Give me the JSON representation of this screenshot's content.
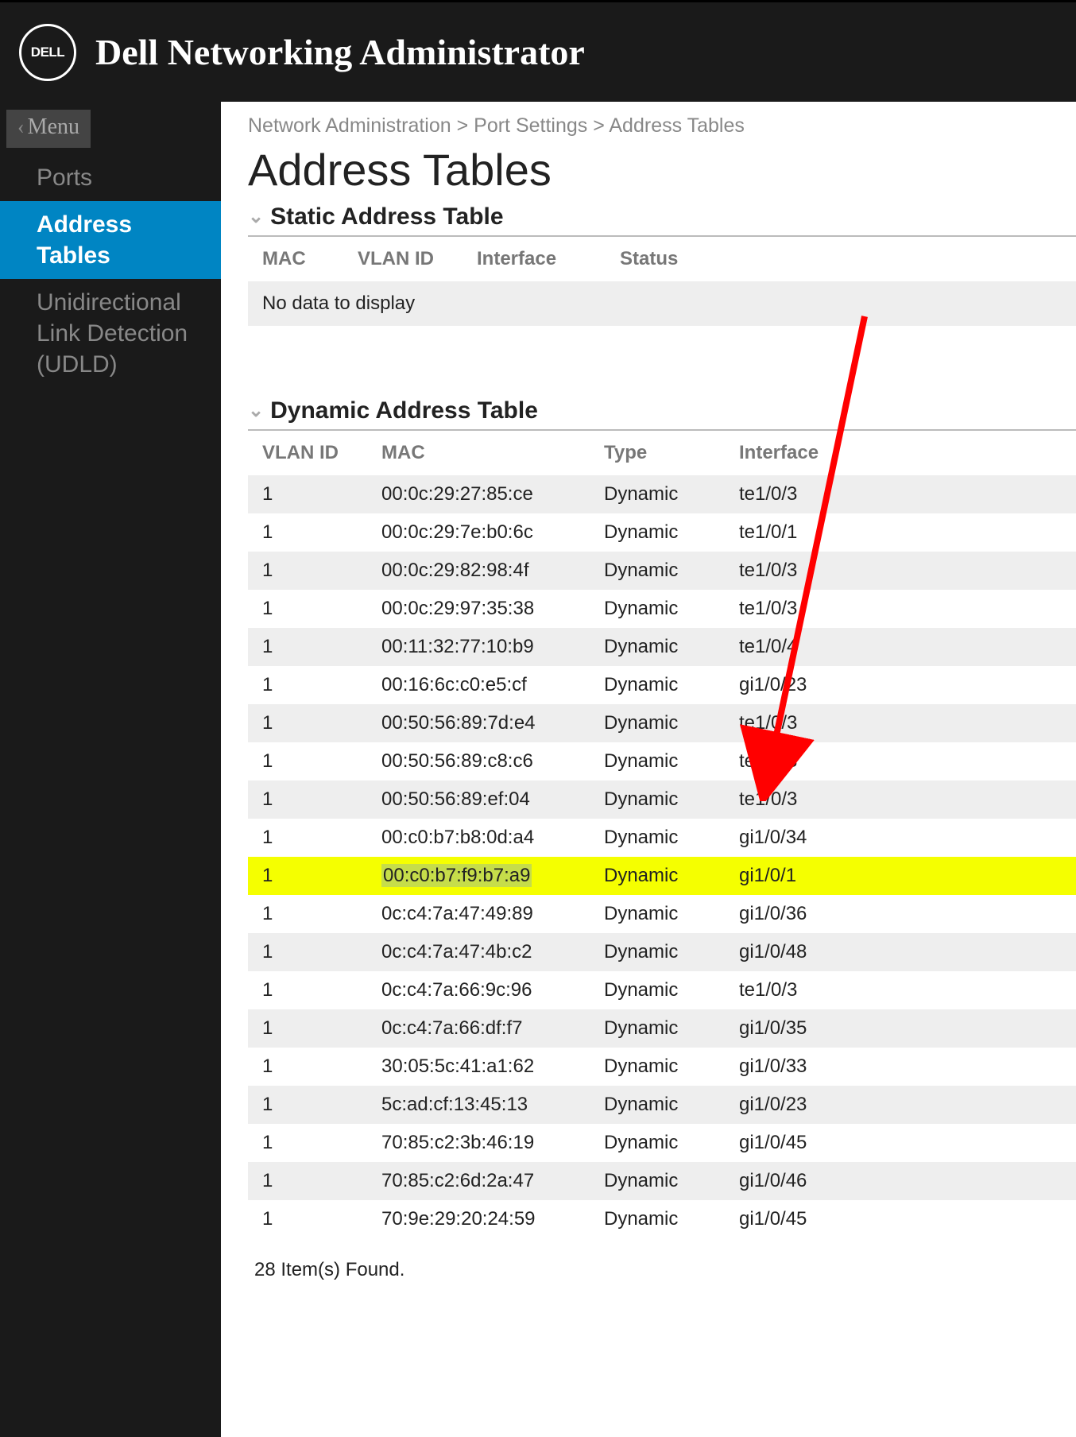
{
  "app": {
    "title": "Dell Networking Administrator",
    "logo_text": "DELL"
  },
  "menu_back": "Menu",
  "sidebar": {
    "items": [
      {
        "label": "Ports",
        "active": false
      },
      {
        "label": "Address Tables",
        "active": true
      },
      {
        "label": "Unidirectional Link Detection (UDLD)",
        "active": false
      }
    ]
  },
  "breadcrumb": "Network Administration > Port Settings > Address Tables",
  "page_title": "Address Tables",
  "static_section": {
    "title": "Static Address Table",
    "columns": [
      "MAC",
      "VLAN ID",
      "Interface",
      "Status"
    ],
    "no_data": "No data to display"
  },
  "dynamic_section": {
    "title": "Dynamic Address Table",
    "columns": [
      "VLAN ID",
      "MAC",
      "Type",
      "Interface"
    ],
    "rows": [
      {
        "vlan": "1",
        "mac": "00:0c:29:27:85:ce",
        "type": "Dynamic",
        "interface": "te1/0/3"
      },
      {
        "vlan": "1",
        "mac": "00:0c:29:7e:b0:6c",
        "type": "Dynamic",
        "interface": "te1/0/1"
      },
      {
        "vlan": "1",
        "mac": "00:0c:29:82:98:4f",
        "type": "Dynamic",
        "interface": "te1/0/3"
      },
      {
        "vlan": "1",
        "mac": "00:0c:29:97:35:38",
        "type": "Dynamic",
        "interface": "te1/0/3"
      },
      {
        "vlan": "1",
        "mac": "00:11:32:77:10:b9",
        "type": "Dynamic",
        "interface": "te1/0/4"
      },
      {
        "vlan": "1",
        "mac": "00:16:6c:c0:e5:cf",
        "type": "Dynamic",
        "interface": "gi1/0/23"
      },
      {
        "vlan": "1",
        "mac": "00:50:56:89:7d:e4",
        "type": "Dynamic",
        "interface": "te1/0/3"
      },
      {
        "vlan": "1",
        "mac": "00:50:56:89:c8:c6",
        "type": "Dynamic",
        "interface": "te1/0/3"
      },
      {
        "vlan": "1",
        "mac": "00:50:56:89:ef:04",
        "type": "Dynamic",
        "interface": "te1/0/3"
      },
      {
        "vlan": "1",
        "mac": "00:c0:b7:b8:0d:a4",
        "type": "Dynamic",
        "interface": "gi1/0/34"
      },
      {
        "vlan": "1",
        "mac": "00:c0:b7:f9:b7:a9",
        "type": "Dynamic",
        "interface": "gi1/0/1",
        "highlight": true
      },
      {
        "vlan": "1",
        "mac": "0c:c4:7a:47:49:89",
        "type": "Dynamic",
        "interface": "gi1/0/36"
      },
      {
        "vlan": "1",
        "mac": "0c:c4:7a:47:4b:c2",
        "type": "Dynamic",
        "interface": "gi1/0/48"
      },
      {
        "vlan": "1",
        "mac": "0c:c4:7a:66:9c:96",
        "type": "Dynamic",
        "interface": "te1/0/3"
      },
      {
        "vlan": "1",
        "mac": "0c:c4:7a:66:df:f7",
        "type": "Dynamic",
        "interface": "gi1/0/35"
      },
      {
        "vlan": "1",
        "mac": "30:05:5c:41:a1:62",
        "type": "Dynamic",
        "interface": "gi1/0/33"
      },
      {
        "vlan": "1",
        "mac": "5c:ad:cf:13:45:13",
        "type": "Dynamic",
        "interface": "gi1/0/23"
      },
      {
        "vlan": "1",
        "mac": "70:85:c2:3b:46:19",
        "type": "Dynamic",
        "interface": "gi1/0/45"
      },
      {
        "vlan": "1",
        "mac": "70:85:c2:6d:2a:47",
        "type": "Dynamic",
        "interface": "gi1/0/46"
      },
      {
        "vlan": "1",
        "mac": "70:9e:29:20:24:59",
        "type": "Dynamic",
        "interface": "gi1/0/45"
      }
    ]
  },
  "items_found": "28 Item(s) Found."
}
